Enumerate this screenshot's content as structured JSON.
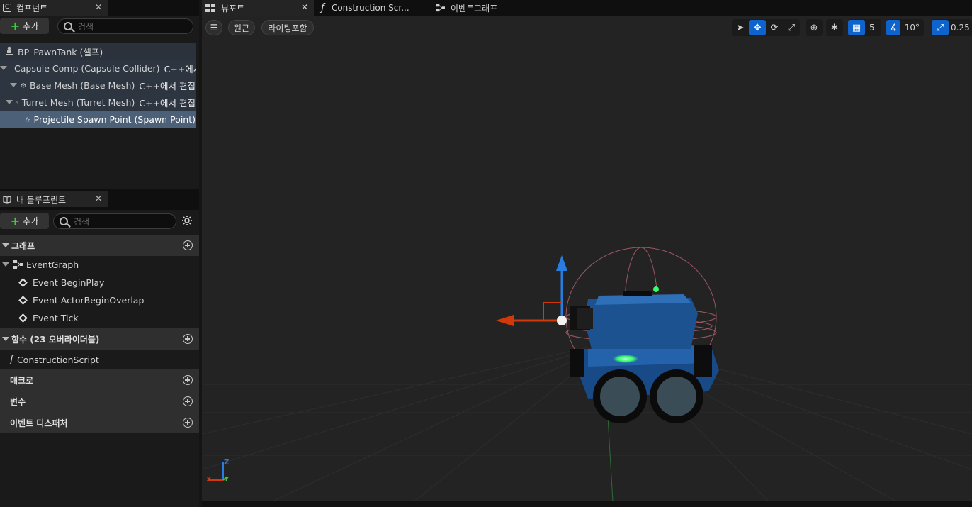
{
  "components_panel": {
    "tab_label": "컴포넌트",
    "add_label": "추가",
    "search_placeholder": "검색",
    "tree": [
      {
        "label": "BP_PawnTank (셀프)",
        "edit": ""
      },
      {
        "label": "Capsule Comp (Capsule Collider)",
        "edit": "C++에서 편집"
      },
      {
        "label": "Base Mesh (Base Mesh)",
        "edit": "C++에서 편집"
      },
      {
        "label": "Turret Mesh (Turret Mesh)",
        "edit": "C++에서 편집"
      },
      {
        "label": "Projectile Spawn Point (Spawn Point)",
        "edit": ""
      }
    ]
  },
  "blueprint_panel": {
    "tab_label": "내 블루프린트",
    "add_label": "추가",
    "search_placeholder": "검색",
    "sections": {
      "graphs": "그래프",
      "functions": "함수 (23 오버라이더블)",
      "macros": "매크로",
      "variables": "변수",
      "dispatchers": "이벤트 디스패처"
    },
    "event_graph": "EventGraph",
    "events": [
      "Event BeginPlay",
      "Event ActorBeginOverlap",
      "Event Tick"
    ],
    "functions": [
      "ConstructionScript"
    ]
  },
  "viewport_tabs": {
    "viewport": "뷰포트",
    "construction": "Construction Scr...",
    "event_graph": "이벤트그래프"
  },
  "viewport_toolbar": {
    "perspective": "원근",
    "lighting": "라이팅포함",
    "grid_size": "5",
    "rotation_snap": "10°",
    "scale_snap": "0.25"
  },
  "axis_labels": {
    "z": "Z",
    "x": "X",
    "y": "Y"
  },
  "colors": {
    "accent": "#0f63cc",
    "selected_row": "#4c6178",
    "add_plus": "#3bd13b",
    "tank_body": "#1a4f8c",
    "glow": "#33ff66"
  }
}
